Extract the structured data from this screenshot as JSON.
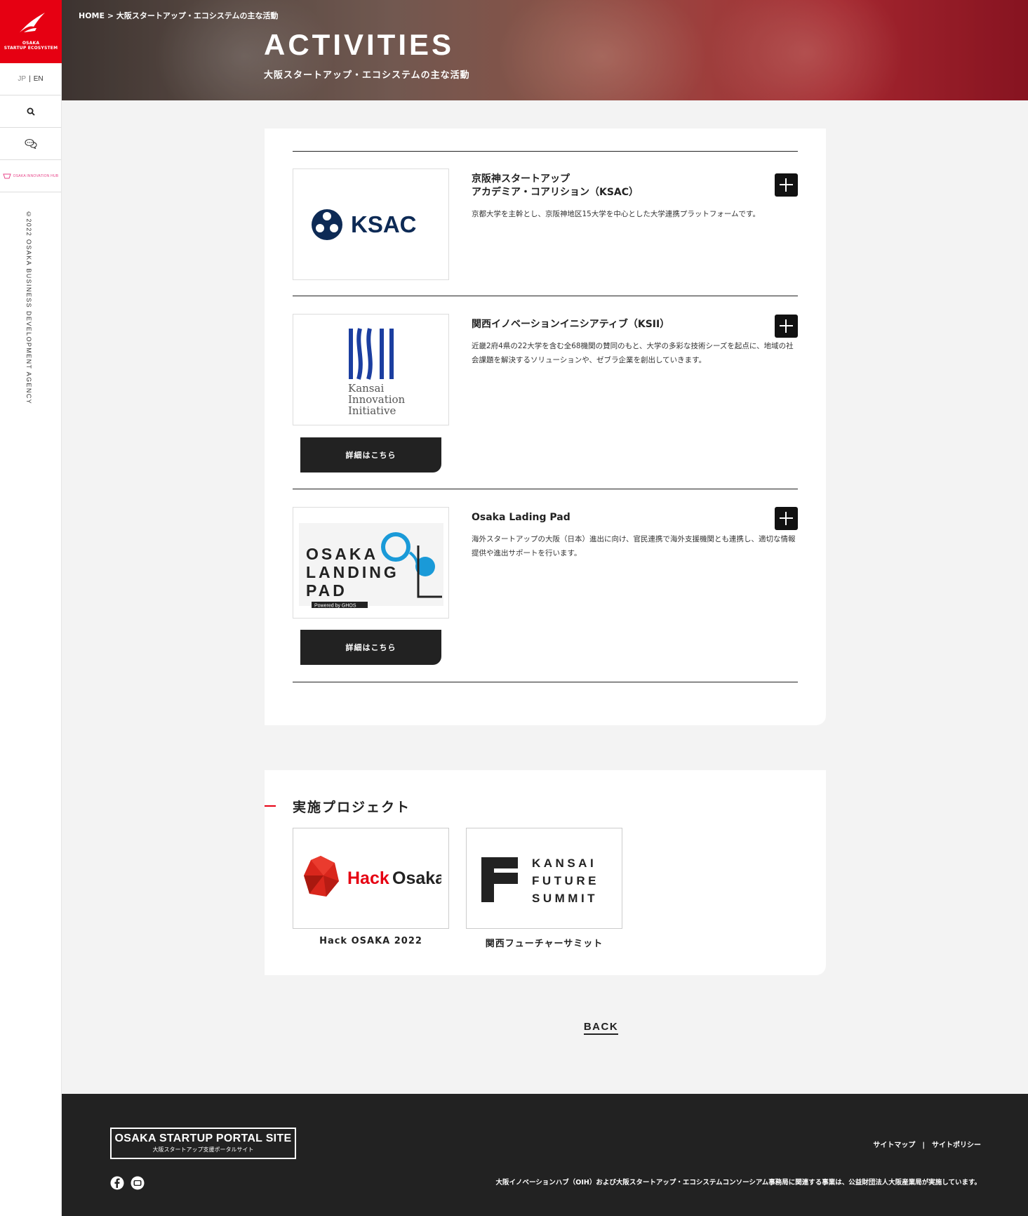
{
  "sidebar": {
    "logo_line1": "OSAKA",
    "logo_line2": "STARTUP ECOSYSTEM",
    "lang_jp": "JP",
    "lang_sep": "|",
    "lang_en": "EN",
    "ohub_label": "OSAKA INNOVATION HUB",
    "copyright": "©2022 OSAKA BUSINESS DEVELOPMENT AGENCY",
    "brand_color": "#e60012"
  },
  "hero": {
    "breadcrumb": "HOME > 大阪スタートアップ・エコシステムの主な活動",
    "title": "ACTIVITIES",
    "subtitle": "大阪スタートアップ・エコシステムの主な活動"
  },
  "activities": [
    {
      "title_line1": "京阪神スタートアップ",
      "title_line2": "アカデミア・コアリション（KSAC）",
      "description": "京都大学を主幹とし、京阪神地区15大学を中心とした大学連携プラットフォームです。",
      "logo_text": "KSAC"
    },
    {
      "title_line1": "関西イノベーションイニシアティブ（KSII）",
      "description": "近畿2府4県の22大学を含む全68機関の賛同のもと、大学の多彩な技術シーズを起点に、地域の社会課題を解決するソリューションや、ゼブラ企業を創出していきます。",
      "logo_line1": "Kansai",
      "logo_line2": "Innovation",
      "logo_line3": "Initiative",
      "button_label": "詳細はこちら"
    },
    {
      "title_line1": "Osaka Lading Pad",
      "description": "海外スタートアップの大阪（日本）進出に向け、官民連携で海外支援機関とも連携し、適切な情報提供や進出サポートを行います。",
      "logo_line1": "OSAKA",
      "logo_line2": "LANDING",
      "logo_line3": "PAD",
      "logo_powered": "Powered by GHOS",
      "button_label": "詳細はこちら"
    }
  ],
  "projects": {
    "heading": "実施プロジェクト",
    "items": [
      {
        "caption": "Hack OSAKA 2022",
        "logo_word1": "Hack",
        "logo_word2": "Osaka"
      },
      {
        "caption": "関西フューチャーサミット",
        "logo_line1": "KANSAI",
        "logo_line2": "FUTURE",
        "logo_line3": "SUMMIT"
      }
    ]
  },
  "back_label": "BACK",
  "footer": {
    "brand_title": "OSAKA STARTUP PORTAL SITE",
    "brand_sub": "大阪スタートアップ支援ポータルサイト",
    "link_sitemap": "サイトマップ",
    "link_sep": "|",
    "link_policy": "サイトポリシー",
    "note": "大阪イノベーションハブ（OIH）および大阪スタートアップ・エコシステムコンソーシアム事務局に関連する事業は、公益財団法人大阪産業局が実施しています。",
    "social_icons": [
      "facebook-icon",
      "youtube-icon"
    ]
  }
}
